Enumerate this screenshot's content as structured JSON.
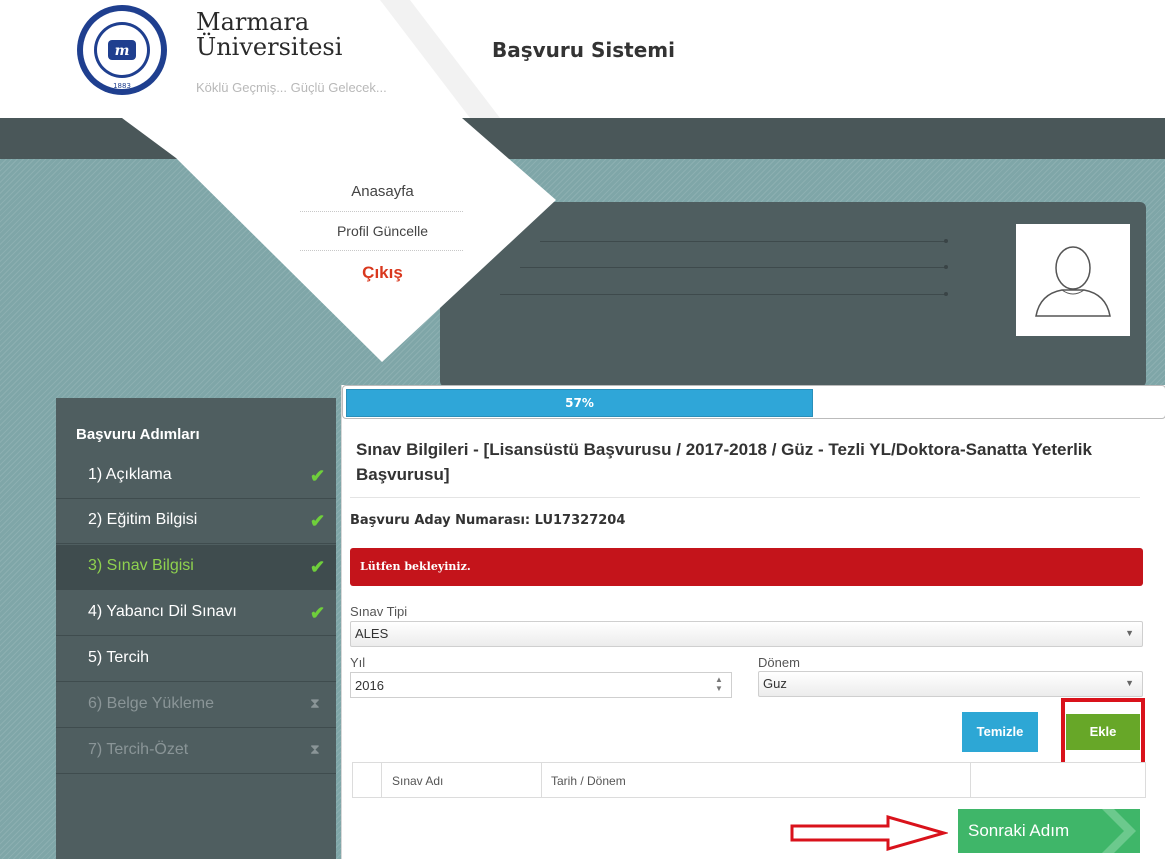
{
  "header": {
    "university_name_line1": "Marmara",
    "university_name_line2": "Üniversitesi",
    "slogan": "Köklü Geçmiş... Güçlü Gelecek...",
    "system_title": "Başvuru Sistemi",
    "seal_text": "MARMARA ÜNİVERSİTESİ",
    "seal_year": "1883"
  },
  "nav_menu": {
    "items": [
      {
        "label": "Anasayfa"
      },
      {
        "label": "Profil Güncelle"
      },
      {
        "label": "Çıkış"
      }
    ],
    "exit_color": "#d9381e"
  },
  "sidebar": {
    "title": "Başvuru Adımları",
    "steps": [
      {
        "label": "1) Açıklama",
        "status": "done",
        "icon": "check-icon"
      },
      {
        "label": "2) Eğitim Bilgisi",
        "status": "done",
        "icon": "check-icon"
      },
      {
        "label": "3) Sınav Bilgisi",
        "status": "active",
        "icon": "check-icon"
      },
      {
        "label": "4) Yabancı Dil Sınavı",
        "status": "done",
        "icon": "check-icon"
      },
      {
        "label": "5) Tercih",
        "status": "pending",
        "icon": ""
      },
      {
        "label": "6) Belge Yükleme",
        "status": "locked",
        "icon": "hourglass-icon"
      },
      {
        "label": "7) Tercih-Özet",
        "status": "locked",
        "icon": "hourglass-icon"
      }
    ]
  },
  "progress": {
    "percent": 57,
    "label": "57%"
  },
  "form": {
    "title": "Sınav Bilgileri - [Lisansüstü Başvurusu / 2017-2018 / Güz - Tezli YL/Doktora-Sanatta Yeterlik Başvurusu]",
    "candidate_number_label": "Başvuru Aday Numarası: LU17327204",
    "alert_text": "Lütfen bekleyiniz.",
    "exam_type_label": "Sınav Tipi",
    "exam_type_value": "ALES",
    "year_label": "Yıl",
    "year_value": "2016",
    "term_label": "Dönem",
    "term_value": "Guz",
    "clear_button": "Temizle",
    "add_button": "Ekle",
    "table_headers": [
      "",
      "Sınav Adı",
      "Tarih / Dönem",
      ""
    ],
    "next_button": "Sonraki Adım"
  },
  "colors": {
    "brand_dark": "#4f5e60",
    "accent_blue": "#2da7d5",
    "accent_green": "#67a728",
    "alert_red": "#c4141b",
    "highlight_red": "#d9121b"
  }
}
